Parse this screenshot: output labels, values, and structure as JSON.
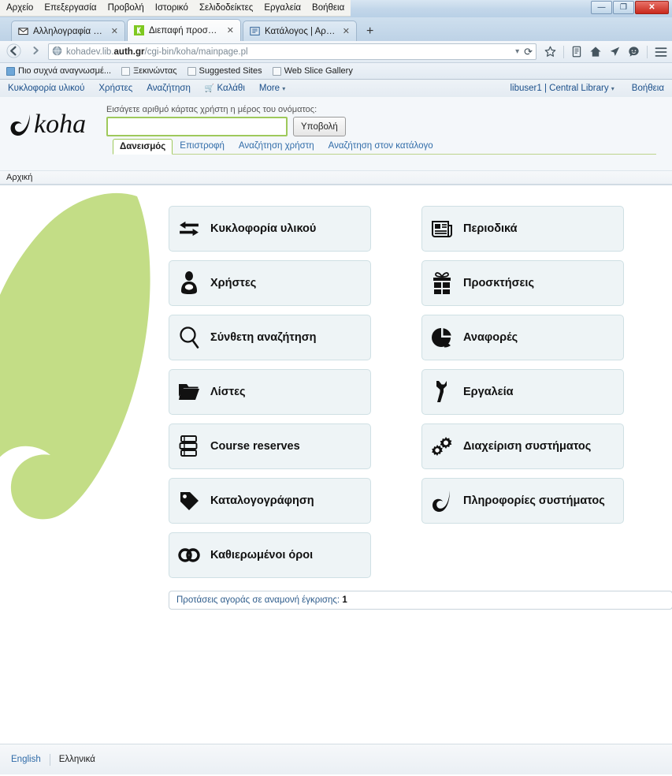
{
  "browser": {
    "menu_items": [
      "Αρχείο",
      "Επεξεργασία",
      "Προβολή",
      "Ιστορικό",
      "Σελιδοδείκτες",
      "Εργαλεία",
      "Βοήθεια"
    ],
    "window_buttons": {
      "minimize": "—",
      "maximize": "❐",
      "close": "✕"
    },
    "tabs": [
      {
        "title": "Αλληλογραφία :: Εισερχόμ...",
        "icon": "mail-icon",
        "active": false,
        "close": "✕"
      },
      {
        "title": "Διεπαφή προσωπικού",
        "icon": "koha-icon",
        "active": true,
        "close": "✕"
      },
      {
        "title": "Κατάλογος | Αριστοτέλειο ...",
        "icon": "catalog-icon",
        "active": false,
        "close": "✕"
      }
    ],
    "new_tab_label": "+",
    "back_label": "◀",
    "forward_label": "▶",
    "url": {
      "prefix": "kohadev.lib.",
      "domain": "auth.gr",
      "path": "/cgi-bin/koha/mainpage.pl"
    },
    "url_dropdown": "▾",
    "reload_label": "⟳",
    "bookmarks": [
      {
        "label": "Πιο συχνά αναγνωσμέ...",
        "icon": "bookmark-blue-icon"
      },
      {
        "label": "Ξεκινώντας",
        "icon": "bookmark-icon"
      },
      {
        "label": "Suggested Sites",
        "icon": "bookmark-icon"
      },
      {
        "label": "Web Slice Gallery",
        "icon": "bookmark-icon"
      }
    ],
    "toolbar_icons": [
      "star-icon",
      "reading-list-icon",
      "home-icon",
      "pocket-icon",
      "sync-smiley-icon",
      "menu-hamburger-icon"
    ]
  },
  "koha": {
    "nav": {
      "items": [
        {
          "label": "Κυκλοφορία υλικού",
          "icon": ""
        },
        {
          "label": "Χρήστες",
          "icon": ""
        },
        {
          "label": "Αναζήτηση",
          "icon": ""
        },
        {
          "label": "Καλάθι",
          "icon": "cart-icon"
        },
        {
          "label": "More",
          "icon": "caret-down-icon"
        }
      ],
      "user": "libuser1",
      "separator": "|",
      "branch": "Central Library",
      "branch_caret": "▾",
      "help": "Βοήθεια"
    },
    "logo_text": "koha",
    "search": {
      "label": "Εισάγετε αριθμό κάρτας χρήστη η μέρος του ονόματος:",
      "value": "",
      "placeholder": "",
      "submit_label": "Υποβολή",
      "tabs": [
        {
          "label": "Δανεισμός",
          "active": true
        },
        {
          "label": "Επιστροφή",
          "active": false
        },
        {
          "label": "Αναζήτηση χρήστη",
          "active": false
        },
        {
          "label": "Αναζήτηση στον κατάλογο",
          "active": false
        }
      ]
    },
    "breadcrumb": "Αρχική",
    "panels_left": [
      {
        "label": "Κυκλοφορία υλικού",
        "icon": "exchange-arrows-icon"
      },
      {
        "label": "Χρήστες",
        "icon": "user-icon"
      },
      {
        "label": "Σύνθετη αναζήτηση",
        "icon": "magnifier-icon"
      },
      {
        "label": "Λίστες",
        "icon": "folder-icon"
      },
      {
        "label": "Course reserves",
        "icon": "books-stack-icon"
      },
      {
        "label": "Καταλογογράφηση",
        "icon": "tag-icon"
      },
      {
        "label": "Καθιερωμένοι όροι",
        "icon": "chain-link-icon"
      }
    ],
    "panels_right": [
      {
        "label": "Περιοδικά",
        "icon": "newspaper-icon"
      },
      {
        "label": "Προσκτήσεις",
        "icon": "gift-icon"
      },
      {
        "label": "Αναφορές",
        "icon": "pie-chart-icon"
      },
      {
        "label": "Εργαλεία",
        "icon": "wrench-icon"
      },
      {
        "label": "Διαχείριση συστήματος",
        "icon": "gears-icon"
      },
      {
        "label": "Πληροφορίες συστήματος",
        "icon": "koha-leaf-icon"
      }
    ],
    "notice": {
      "text": "Προτάσεις αγοράς σε αναμονή έγκρισης:",
      "count": "1"
    },
    "footer": {
      "lang_other": "English",
      "lang_current": "Ελληνικά"
    }
  },
  "colors": {
    "koha_green": "#c3dd86",
    "panel_bg": "#eef4f6",
    "panel_border": "#cfe0e4",
    "link_blue": "#2f6ba8",
    "nav_blue": "#1b4f8a",
    "input_border_green": "#9ec95b"
  }
}
